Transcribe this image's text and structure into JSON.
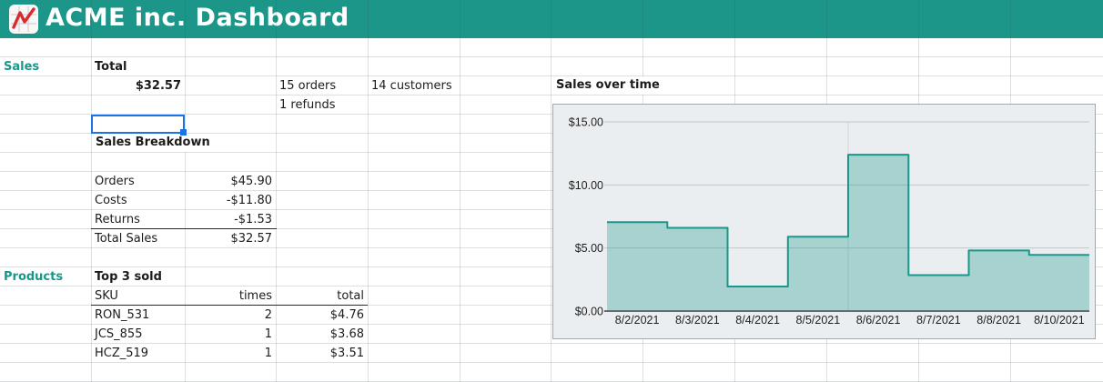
{
  "header": {
    "title": "ACME inc. Dashboard"
  },
  "colors": {
    "header_bg": "#1b9689",
    "accent_teal": "#17988b",
    "selection_blue": "#1a73e8",
    "logo_red": "#d92b2b",
    "chart_stroke": "#17988a",
    "chart_fill": "rgba(24,152,138,0.32)",
    "chart_panel_bg": "#ebeef0"
  },
  "sales": {
    "section_label": "Sales",
    "total_label": "Total",
    "total_value": "$32.57",
    "orders_count": "15 orders",
    "customers_count": "14 customers",
    "refunds_count": "1 refunds",
    "breakdown_title": "Sales Breakdown",
    "breakdown_rows": [
      {
        "label": "Orders",
        "value": "$45.90"
      },
      {
        "label": "Costs",
        "value": "-$11.80"
      },
      {
        "label": "Returns",
        "value": "-$1.53"
      },
      {
        "label": "Total Sales",
        "value": "$32.57"
      }
    ]
  },
  "products": {
    "section_label": "Products",
    "title": "Top 3 sold",
    "columns": [
      "SKU",
      "times",
      "total"
    ],
    "rows": [
      [
        "RON_531",
        "2",
        "$4.76"
      ],
      [
        "JCS_855",
        "1",
        "$3.68"
      ],
      [
        "HCZ_519",
        "1",
        "$3.51"
      ]
    ]
  },
  "chart_data": {
    "type": "area",
    "step": true,
    "title": "Sales over time",
    "categories": [
      "8/2/2021",
      "8/3/2021",
      "8/4/2021",
      "8/5/2021",
      "8/6/2021",
      "8/7/2021",
      "8/8/2021",
      "8/10/2021"
    ],
    "values": [
      7.05,
      6.6,
      1.95,
      5.9,
      12.4,
      2.85,
      4.8,
      4.45
    ],
    "xlabel": "",
    "ylabel": "",
    "ylim": [
      0,
      15
    ],
    "y_ticks": [
      "$0.00",
      "$5.00",
      "$10.00",
      "$15.00"
    ],
    "grid": true,
    "legend": "none"
  }
}
